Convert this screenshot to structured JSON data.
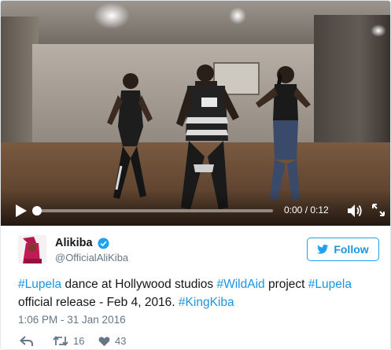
{
  "video": {
    "time_display": "0:00 / 0:12",
    "progress_fraction": 0.0
  },
  "tweet": {
    "author_name": "Alikiba",
    "author_handle": "@OfficialAliKiba",
    "verified": true,
    "follow_label": "Follow",
    "text": [
      {
        "type": "hashtag",
        "value": "#Lupela"
      },
      {
        "type": "text",
        "value": " dance at Hollywood studios "
      },
      {
        "type": "hashtag",
        "value": "#WildAid"
      },
      {
        "type": "text",
        "value": " project "
      },
      {
        "type": "hashtag",
        "value": "#Lupela"
      },
      {
        "type": "text",
        "value": " official release - Feb 4, 2016. "
      },
      {
        "type": "hashtag",
        "value": "#KingKiba"
      }
    ],
    "timestamp": "1:06 PM - 31 Jan 2016",
    "actions": {
      "reply_icon": "reply-icon",
      "retweet_icon": "retweet-icon",
      "retweet_count": "16",
      "like_icon": "heart-icon",
      "like_count": "43"
    }
  },
  "colors": {
    "link": "#1b95e0",
    "verified": "#1da1f2",
    "text": "#14171a",
    "muted": "#657786"
  }
}
